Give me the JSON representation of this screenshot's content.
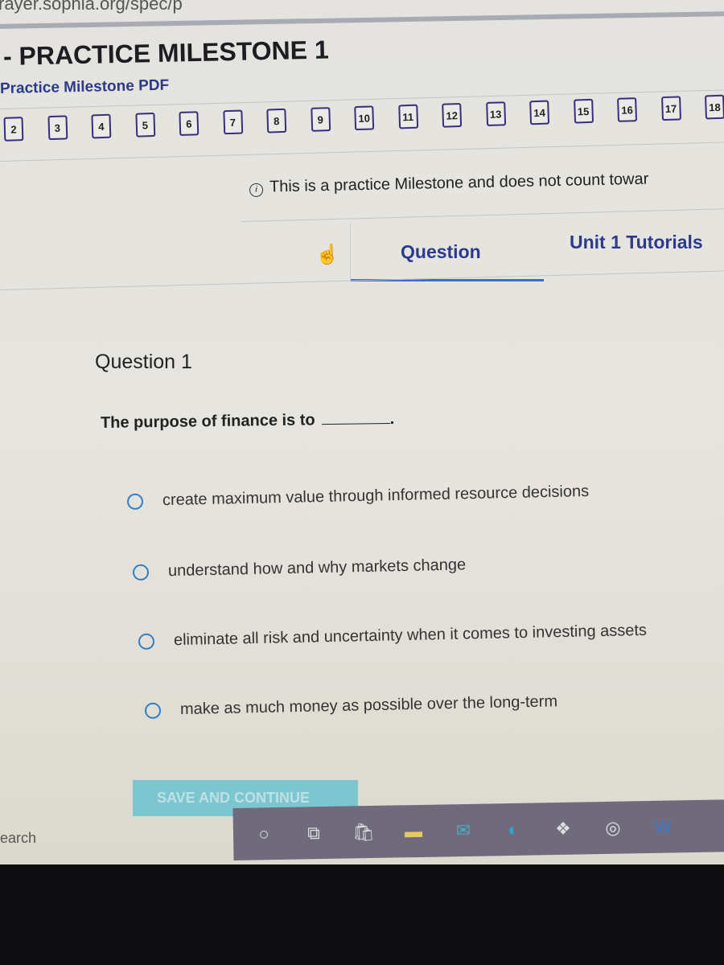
{
  "browser": {
    "url_fragment": "rayer.sophia.org/spec/p"
  },
  "page": {
    "title": "- PRACTICE MILESTONE 1",
    "pdf_link": "Practice Milestone PDF",
    "question_numbers": [
      "2",
      "3",
      "4",
      "5",
      "6",
      "7",
      "8",
      "9",
      "10",
      "11",
      "12",
      "13",
      "14",
      "15",
      "16",
      "17",
      "18"
    ],
    "info_text": "This is a practice Milestone and does not count towar",
    "tabs": [
      {
        "label": "Question",
        "active": true
      },
      {
        "label": "Unit 1 Tutorials",
        "active": false
      }
    ],
    "question_heading": "Question 1",
    "question_prompt": "The purpose of finance is to",
    "question_suffix": ".",
    "options": [
      "create maximum value through informed resource decisions",
      "understand how and why markets change",
      "eliminate all risk and uncertainty when it comes to investing assets",
      "make as much money as possible over the long-term"
    ],
    "save_button": "SAVE AND CONTINUE"
  },
  "taskbar": {
    "search_label": "earch",
    "icons": [
      "cortana-icon",
      "task-view-icon",
      "store-icon",
      "file-explorer-icon",
      "mail-icon",
      "edge-icon",
      "dropbox-icon",
      "app-icon",
      "word-icon"
    ]
  },
  "colors": {
    "accent": "#2c3a8c",
    "tab_underline": "#3c6ed0",
    "radio": "#2f7fc7",
    "save_button": "#7cc7cf"
  }
}
